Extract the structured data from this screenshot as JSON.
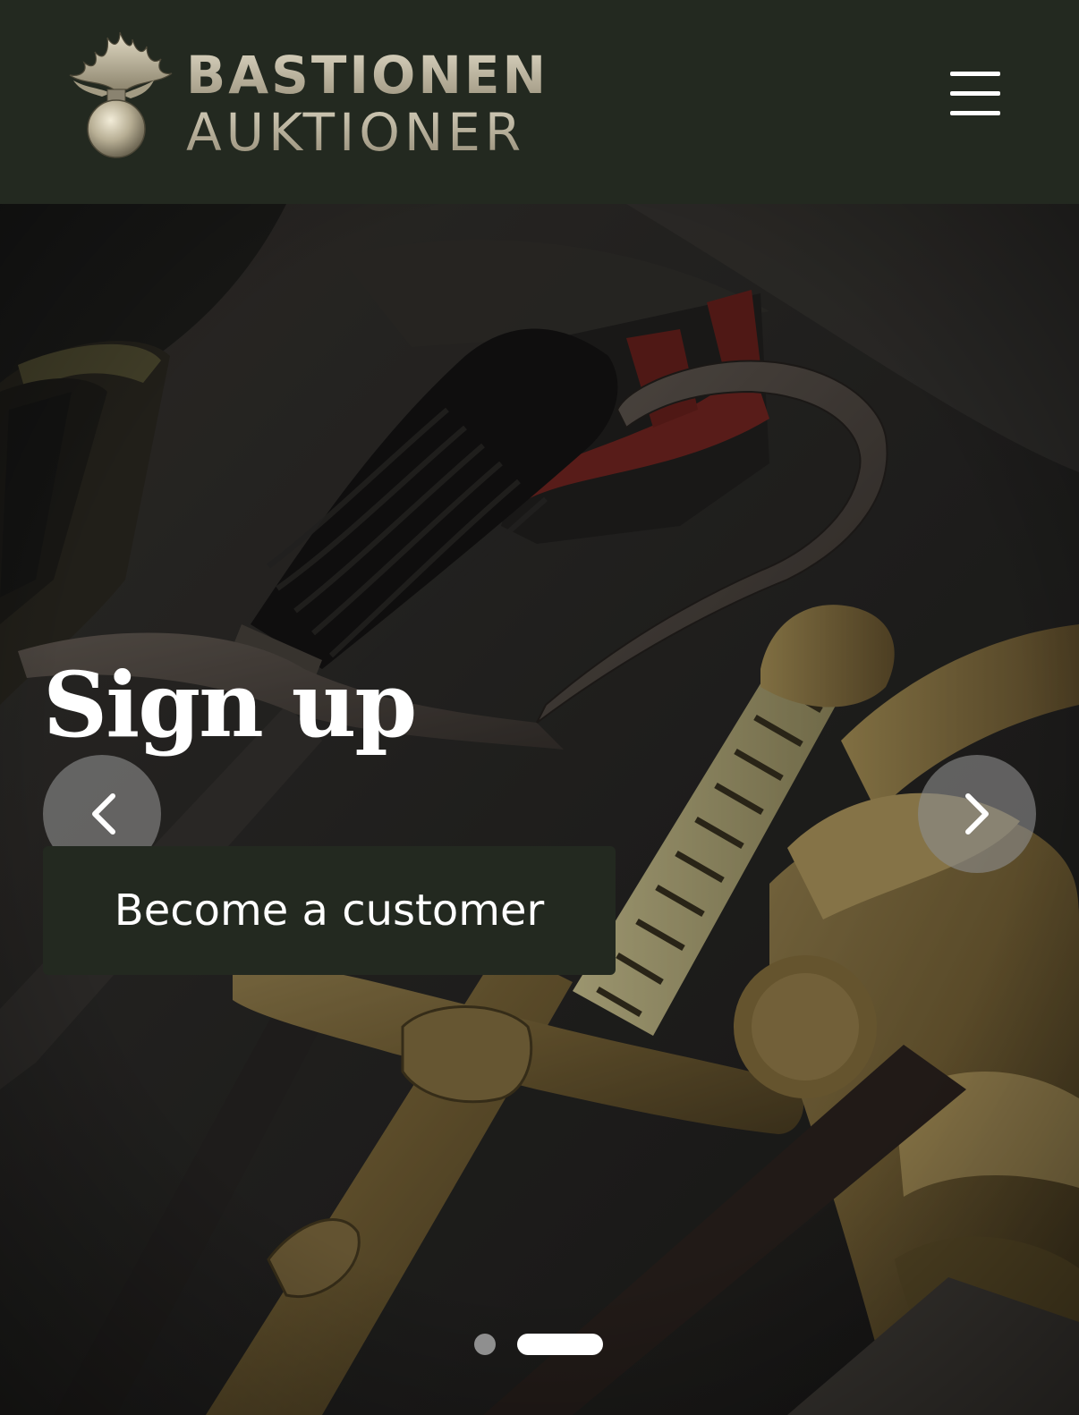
{
  "header": {
    "logo": {
      "line1": "BASTIONEN",
      "line2": "AUKTIONER",
      "emblem_icon": "grenade-emblem-icon"
    },
    "menu_icon": "hamburger-menu-icon"
  },
  "hero": {
    "title": "Sign up",
    "cta_label": "Become a customer",
    "prev_icon": "chevron-left-icon",
    "next_icon": "chevron-right-icon",
    "slides": [
      {
        "active": false
      },
      {
        "active": true
      }
    ]
  },
  "colors": {
    "header_bg": "#232920",
    "button_bg": "#232920",
    "logo_gold": "#bdb6a0",
    "text": "#ffffff"
  }
}
